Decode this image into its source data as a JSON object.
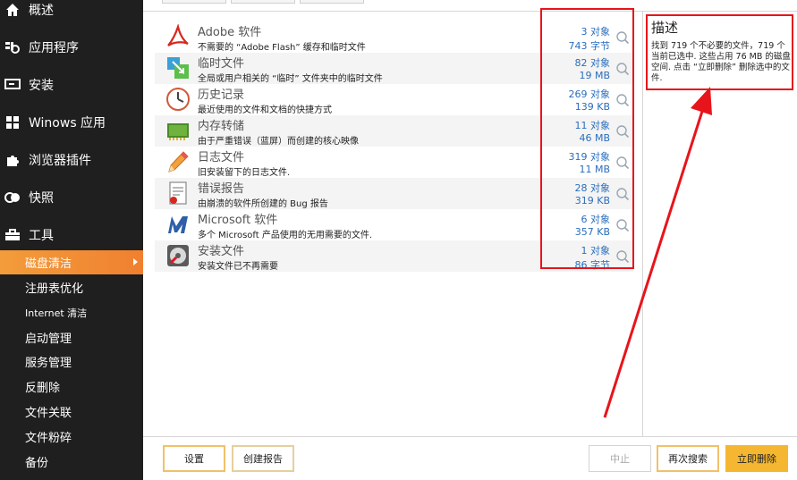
{
  "sidebar": {
    "main_items": [
      {
        "label": "概述",
        "icon": "home-icon"
      },
      {
        "label": "应用程序",
        "icon": "apps-icon"
      },
      {
        "label": "安装",
        "icon": "install-icon"
      },
      {
        "label": "Winows 应用",
        "icon": "windows-icon"
      },
      {
        "label": "浏览器插件",
        "icon": "puzzle-icon"
      },
      {
        "label": "快照",
        "icon": "snapshot-icon"
      },
      {
        "label": "工具",
        "icon": "toolbox-icon"
      }
    ],
    "sub_items": [
      {
        "label": "磁盘清洁",
        "active": true
      },
      {
        "label": "注册表优化"
      },
      {
        "label": "Internet 清洁"
      },
      {
        "label": "启动管理"
      },
      {
        "label": "服务管理"
      },
      {
        "label": "反删除"
      },
      {
        "label": "文件关联"
      },
      {
        "label": "文件粉碎"
      },
      {
        "label": "备份"
      }
    ]
  },
  "list": {
    "rows": [
      {
        "title": "Adobe 软件",
        "desc": "不需要的 “Adobe Flash” 缓存和临时文件",
        "count": "3 对象",
        "size": "743 字节",
        "icon": "adobe-icon"
      },
      {
        "title": "临时文件",
        "desc": "全局或用户相关的 “临时” 文件夹中的临时文件",
        "count": "82 对象",
        "size": "19 MB",
        "icon": "temp-files-icon"
      },
      {
        "title": "历史记录",
        "desc": "最近使用的文件和文档的快捷方式",
        "count": "269 对象",
        "size": "139 KB",
        "icon": "clock-icon"
      },
      {
        "title": "内存转储",
        "desc": "由于严重错误（蓝屏）而创建的核心映像",
        "count": "11 对象",
        "size": "46 MB",
        "icon": "memory-chip-icon"
      },
      {
        "title": "日志文件",
        "desc": "旧安装留下的日志文件.",
        "count": "319 对象",
        "size": "11 MB",
        "icon": "pencil-icon"
      },
      {
        "title": "错误报告",
        "desc": "由崩溃的软件所创建的 Bug 报告",
        "count": "28 对象",
        "size": "319 KB",
        "icon": "report-icon"
      },
      {
        "title": "Microsoft 软件",
        "desc": "多个 Microsoft 产品使用的无用需要的文件.",
        "count": "6 对象",
        "size": "357 KB",
        "icon": "microsoft-m-icon"
      },
      {
        "title": "安装文件",
        "desc": "安装文件已不再需要",
        "count": "1 对象",
        "size": "86 字节",
        "icon": "install-disk-icon"
      }
    ]
  },
  "description": {
    "title": "描述",
    "text": "找到 719 个不必要的文件，719 个当前已选中. 这些占用 76 MB 的磁盘空间. 点击 “立即删除” 删除选中的文件."
  },
  "buttons": {
    "settings": "设置",
    "create_report": "创建报告",
    "stop": "中止",
    "search_again": "再次搜索",
    "delete_now": "立即删除"
  },
  "colors": {
    "sidebar_bg": "#1f1f1f",
    "active_item": "#f08030",
    "accent_red": "#e8141b",
    "link_blue": "#2a6ebd",
    "primary_button": "#f5b731"
  }
}
